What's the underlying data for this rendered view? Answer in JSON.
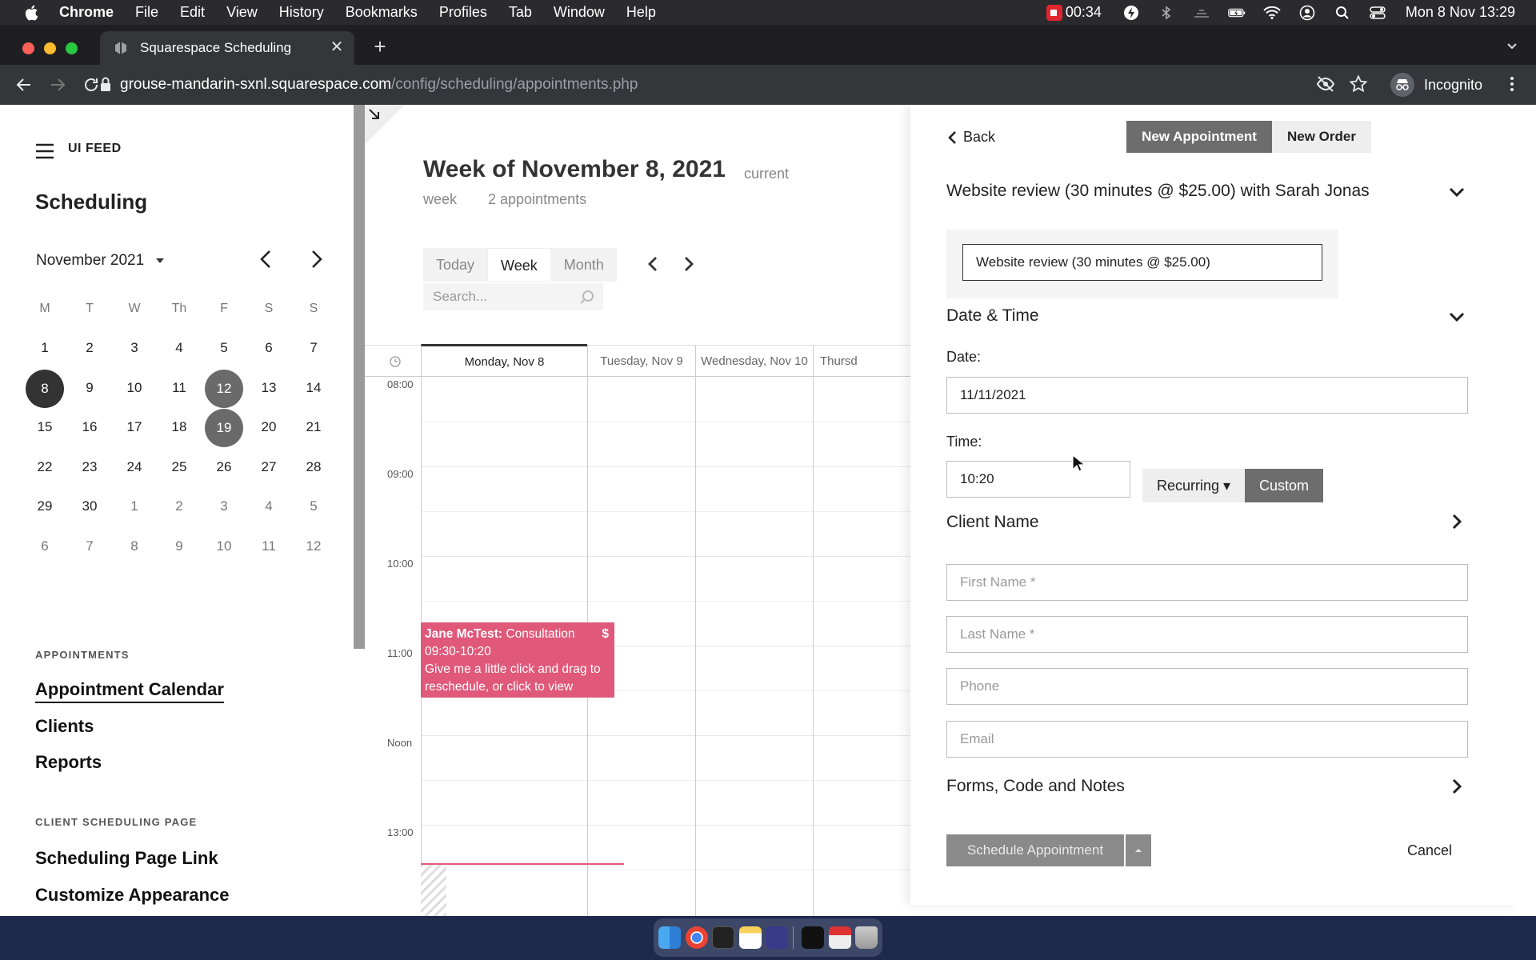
{
  "menubar": {
    "app": "Chrome",
    "items": [
      "File",
      "Edit",
      "View",
      "History",
      "Bookmarks",
      "Profiles",
      "Tab",
      "Window",
      "Help"
    ],
    "recording_time": "00:34",
    "clock": "Mon 8 Nov  13:29"
  },
  "browser": {
    "tab_title": "Squarespace Scheduling",
    "url_host": "grouse-mandarin-sxnl.squarespace.com",
    "url_path": "/config/scheduling/appointments.php",
    "profile_label": "Incognito"
  },
  "sidebar": {
    "site_name": "UI FEED",
    "title": "Scheduling",
    "mini_calendar": {
      "month_label": "November 2021",
      "weekday_headers": [
        "M",
        "T",
        "W",
        "Th",
        "F",
        "S",
        "S"
      ],
      "weeks": [
        [
          "1",
          "2",
          "3",
          "4",
          "5",
          "6",
          "7"
        ],
        [
          "8",
          "9",
          "10",
          "11",
          "12",
          "13",
          "14"
        ],
        [
          "15",
          "16",
          "17",
          "18",
          "19",
          "20",
          "21"
        ],
        [
          "22",
          "23",
          "24",
          "25",
          "26",
          "27",
          "28"
        ],
        [
          "29",
          "30",
          "1",
          "2",
          "3",
          "4",
          "5"
        ],
        [
          "6",
          "7",
          "8",
          "9",
          "10",
          "11",
          "12"
        ]
      ],
      "selected_day": "8",
      "marked_days": [
        "12",
        "19"
      ]
    },
    "appointments_heading": "APPOINTMENTS",
    "appointments_links": [
      "Appointment Calendar",
      "Clients",
      "Reports"
    ],
    "client_page_heading": "CLIENT SCHEDULING PAGE",
    "client_page_links": [
      "Scheduling Page Link",
      "Customize Appearance"
    ]
  },
  "calendar": {
    "week_title": "Week of November 8, 2021",
    "current_label": "current",
    "week_label": "week",
    "appointment_count": "2 appointments",
    "view_buttons": [
      "Today",
      "Week",
      "Month"
    ],
    "active_view": "Week",
    "search_placeholder": "Search...",
    "day_headers": [
      "Monday, Nov 8",
      "Tuesday, Nov 9",
      "Wednesday, Nov 10",
      "Thursd"
    ],
    "hours": [
      "08:00",
      "09:00",
      "10:00",
      "11:00",
      "Noon",
      "13:00"
    ],
    "event": {
      "client": "Jane McTest:",
      "type": "Consultation",
      "time": "09:30-10:20",
      "note": "Give me a little click and drag to reschedule, or click to view",
      "paid_symbol": "$"
    }
  },
  "panel": {
    "back_label": "Back",
    "tabs": [
      "New Appointment",
      "New Order"
    ],
    "service_heading": "Website review (30 minutes @ $25.00) with Sarah Jonas",
    "service_select_value": "Website review (30 minutes @ $25.00)",
    "datetime_heading": "Date & Time",
    "date_label": "Date:",
    "date_value": "11/11/2021",
    "time_label": "Time:",
    "time_value": "10:20",
    "recurring_label": "Recurring",
    "custom_label": "Custom",
    "client_heading": "Client Name",
    "first_name_placeholder": "First Name *",
    "last_name_placeholder": "Last Name *",
    "phone_placeholder": "Phone",
    "email_placeholder": "Email",
    "forms_heading": "Forms, Code and Notes",
    "schedule_label": "Schedule Appointment",
    "cancel_label": "Cancel"
  }
}
